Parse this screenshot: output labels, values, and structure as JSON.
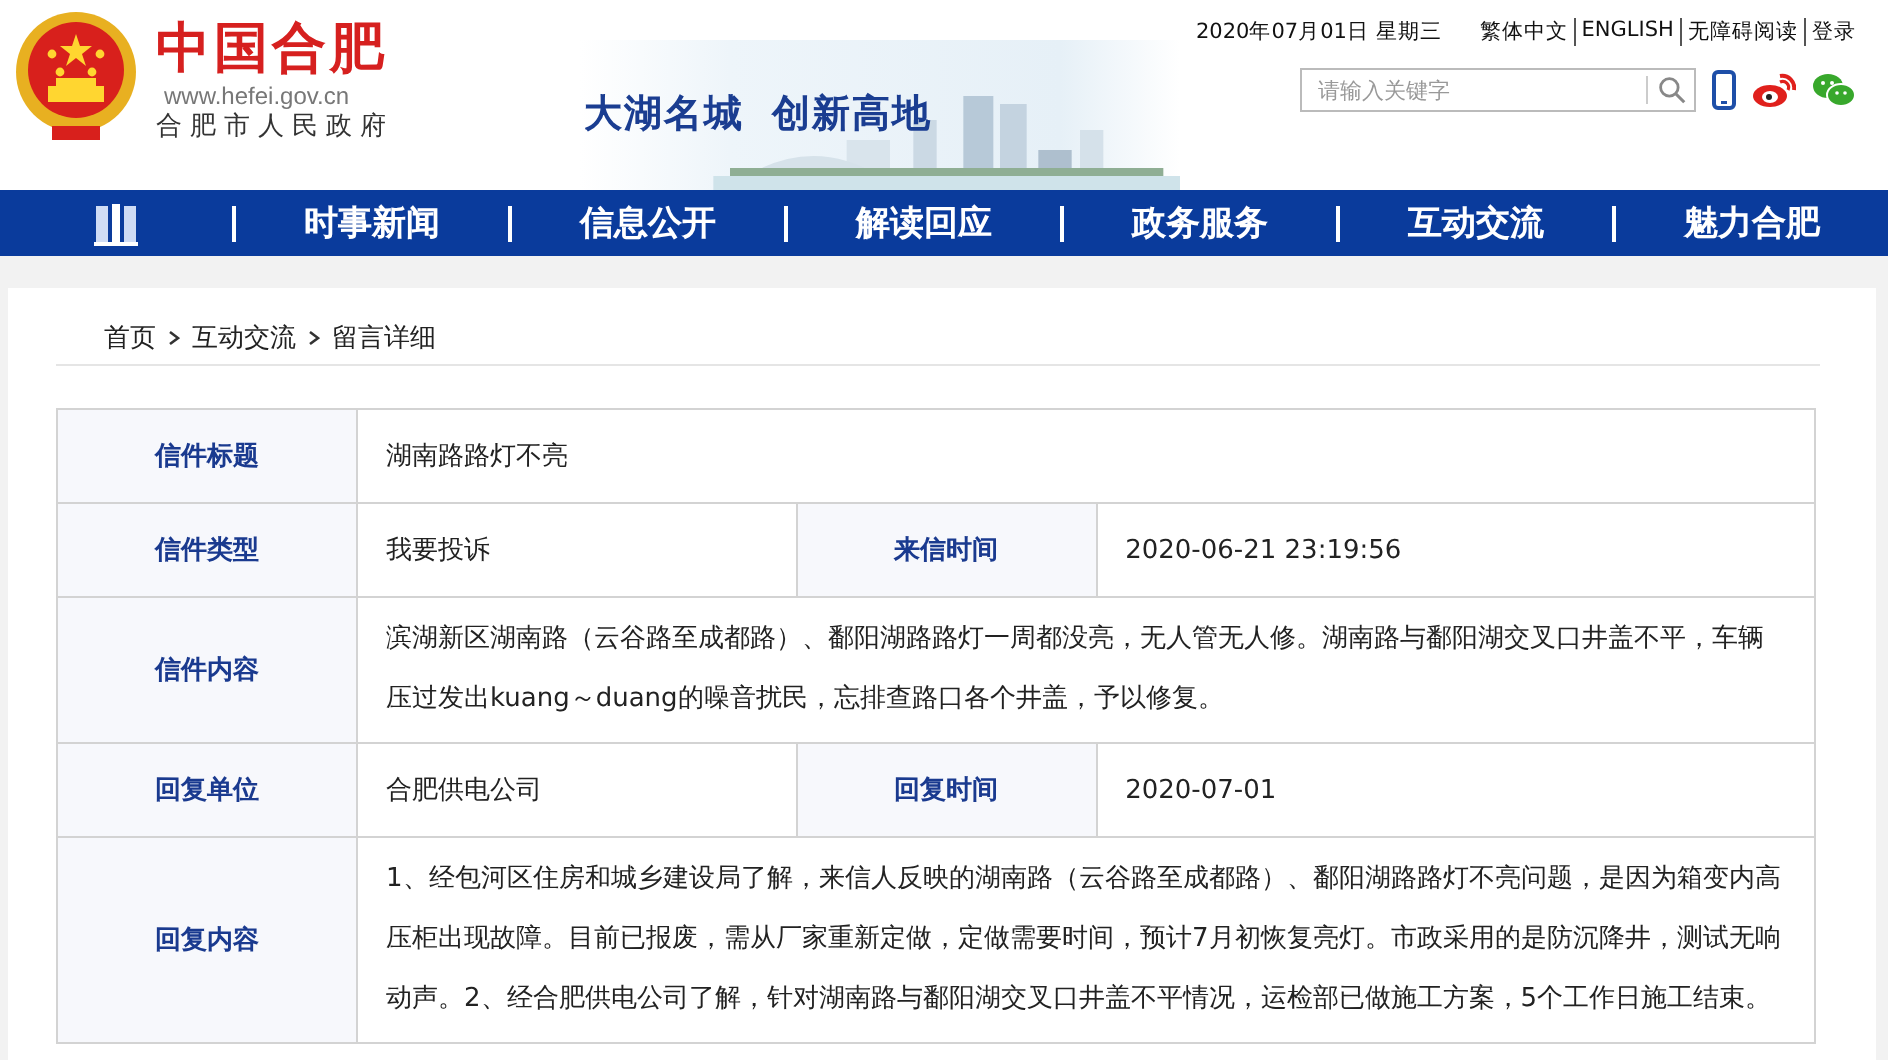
{
  "header": {
    "logo_title": "中国合肥",
    "logo_url": "www.hefei.gov.cn",
    "logo_subtitle": "合肥市人民政府",
    "slogan": [
      "大湖名城",
      "创新高地"
    ],
    "date": "2020年07月01日 星期三",
    "top_links": [
      "繁体中文",
      "ENGLISH",
      "无障碍阅读",
      "登录"
    ],
    "search": {
      "placeholder": "请输入关键字"
    }
  },
  "nav": {
    "items": [
      "时事新闻",
      "信息公开",
      "解读回应",
      "政务服务",
      "互动交流",
      "魅力合肥"
    ]
  },
  "breadcrumb": [
    "首页",
    "互动交流",
    "留言详细"
  ],
  "letter": {
    "rows": [
      {
        "cells": [
          {
            "label": "信件标题",
            "value": "湖南路路灯不亮"
          }
        ]
      },
      {
        "cells": [
          {
            "label": "信件类型",
            "value": "我要投诉"
          },
          {
            "label": "来信时间",
            "value": "2020-06-21 23:19:56"
          }
        ]
      },
      {
        "cells": [
          {
            "label": "信件内容",
            "value": "滨湖新区湖南路（云谷路至成都路）、鄱阳湖路路灯一周都没亮，无人管无人修。湖南路与鄱阳湖交叉口井盖不平，车辆压过发出kuang～duang的噪音扰民，忘排查路口各个井盖，予以修复。"
          }
        ]
      },
      {
        "cells": [
          {
            "label": "回复单位",
            "value": "合肥供电公司"
          },
          {
            "label": "回复时间",
            "value": "2020-07-01"
          }
        ]
      },
      {
        "cells": [
          {
            "label": "回复内容",
            "value": "1、经包河区住房和城乡建设局了解，来信人反映的湖南路（云谷路至成都路）、鄱阳湖路路灯不亮问题，是因为箱变内高压柜出现故障。目前已报废，需从厂家重新定做，定做需要时间，预计7月初恢复亮灯。市政采用的是防沉降井，测试无响动声。2、经合肥供电公司了解，针对湖南路与鄱阳湖交叉口井盖不平情况，运检部已做施工方案，5个工作日施工结束。"
          }
        ]
      }
    ]
  }
}
